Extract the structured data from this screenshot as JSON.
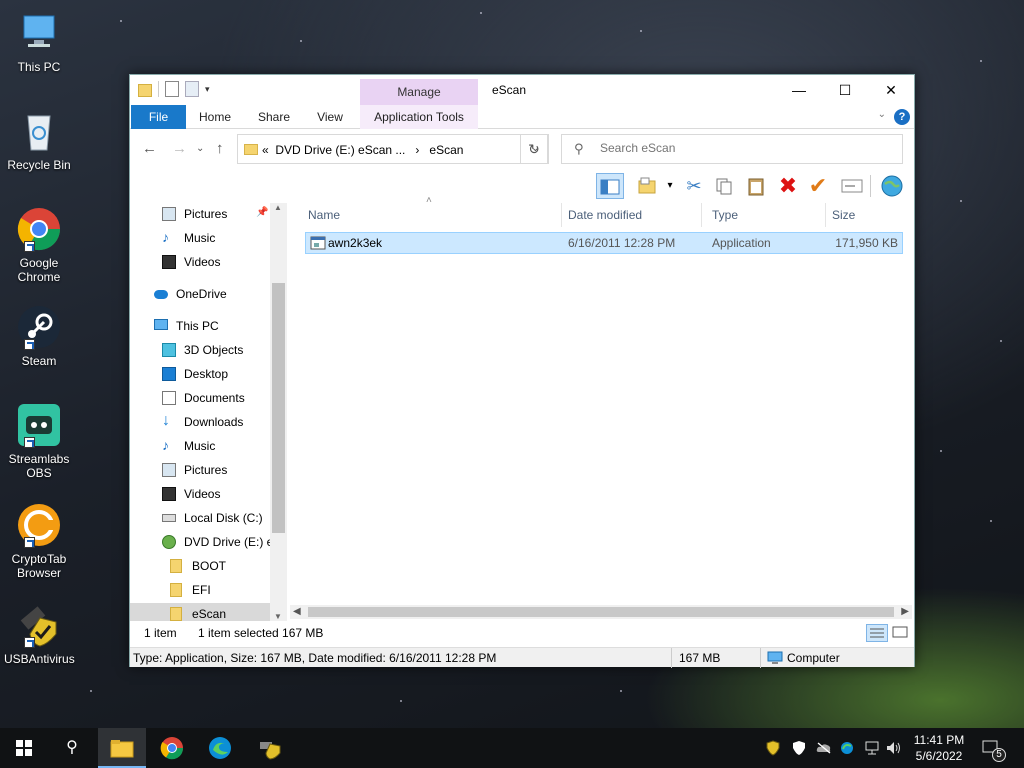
{
  "desktop": {
    "icons": [
      {
        "label": "This PC"
      },
      {
        "label": "Recycle Bin"
      },
      {
        "label": "Google Chrome"
      },
      {
        "label": "Steam"
      },
      {
        "label": "Streamlabs OBS"
      },
      {
        "label": "CryptoTab Browser"
      },
      {
        "label": "USBAntivirus"
      }
    ]
  },
  "window": {
    "title": "eScan",
    "manage_tab": "Manage",
    "tabs": {
      "file": "File",
      "home": "Home",
      "share": "Share",
      "view": "View",
      "app_tools": "Application Tools"
    },
    "address": {
      "path_prefix": "«",
      "crumb1": "DVD Drive (E:) eScan ...",
      "crumb_sep": "›",
      "crumb2": "eScan"
    },
    "search_placeholder": "Search eScan",
    "nav": {
      "items": [
        {
          "label": "Pictures"
        },
        {
          "label": "Music"
        },
        {
          "label": "Videos"
        },
        {
          "label": "OneDrive"
        },
        {
          "label": "This PC"
        },
        {
          "label": "3D Objects"
        },
        {
          "label": "Desktop"
        },
        {
          "label": "Documents"
        },
        {
          "label": "Downloads"
        },
        {
          "label": "Music"
        },
        {
          "label": "Pictures"
        },
        {
          "label": "Videos"
        },
        {
          "label": "Local Disk (C:)"
        },
        {
          "label": "DVD Drive (E:) eS"
        },
        {
          "label": "BOOT"
        },
        {
          "label": "EFI"
        },
        {
          "label": "eScan"
        }
      ]
    },
    "columns": {
      "name": "Name",
      "date": "Date modified",
      "type": "Type",
      "size": "Size"
    },
    "files": [
      {
        "name": "awn2k3ek",
        "date": "6/16/2011 12:28 PM",
        "type": "Application",
        "size": "171,950 KB"
      }
    ],
    "status": {
      "count": "1 item",
      "selected": "1 item selected  167 MB"
    },
    "details_bar": {
      "info": "Type: Application, Size: 167 MB, Date modified: 6/16/2011 12:28 PM",
      "size": "167 MB",
      "location": "Computer"
    }
  },
  "taskbar": {
    "time": "11:41 PM",
    "date": "5/6/2022",
    "notifications": "5"
  },
  "colors": {
    "accent": "#1979ca",
    "selection": "#cce8ff",
    "manage": "#e9d3f3"
  }
}
